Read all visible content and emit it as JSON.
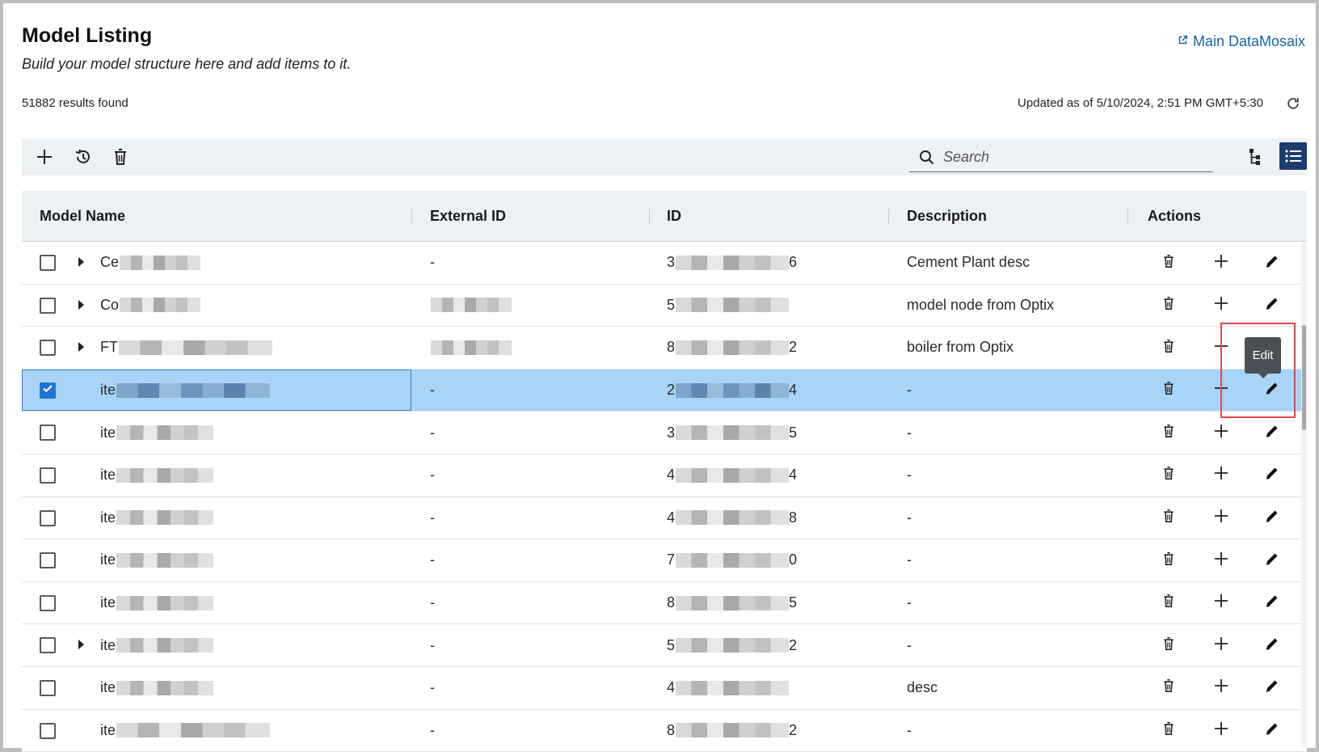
{
  "page": {
    "title": "Model Listing",
    "subtitle": "Build your model structure here and add items to it.",
    "main_link": "Main DataMosaix",
    "results": "51882 results found",
    "updated": "Updated as of 5/10/2024, 2:51 PM GMT+5:30"
  },
  "toolbar": {
    "search_placeholder": "Search"
  },
  "table": {
    "columns": [
      "Model Name",
      "External ID",
      "ID",
      "Description",
      "Actions"
    ],
    "rows": [
      {
        "name": "Ce",
        "ext": "-",
        "id_start": "3",
        "id_end": "6",
        "desc": "Cement Plant desc"
      },
      {
        "name": "Co",
        "ext": "",
        "id_start": "5",
        "id_end": "",
        "desc": "model node from Optix"
      },
      {
        "name": "FT",
        "ext": "",
        "id_start": "8",
        "id_end": "2",
        "desc": "boiler from Optix"
      },
      {
        "name": "ite",
        "ext": "-",
        "id_start": "2",
        "id_end": "4",
        "desc": "-"
      },
      {
        "name": "ite",
        "ext": "-",
        "id_start": "3",
        "id_end": "5",
        "desc": "-"
      },
      {
        "name": "ite",
        "ext": "-",
        "id_start": "4",
        "id_end": "4",
        "desc": "-"
      },
      {
        "name": "ite",
        "ext": "-",
        "id_start": "4",
        "id_end": "8",
        "desc": "-"
      },
      {
        "name": "ite",
        "ext": "-",
        "id_start": "7",
        "id_end": "0",
        "desc": "-"
      },
      {
        "name": "ite",
        "ext": "-",
        "id_start": "8",
        "id_end": "5",
        "desc": "-"
      },
      {
        "name": "ite",
        "ext": "-",
        "id_start": "5",
        "id_end": "2",
        "desc": "-"
      },
      {
        "name": "ite",
        "ext": "-",
        "id_start": "4",
        "id_end": "",
        "desc": "desc"
      },
      {
        "name": "ite",
        "ext": "-",
        "id_start": "8",
        "id_end": "2",
        "desc": "-"
      }
    ]
  },
  "tooltip": {
    "text": "Edit"
  },
  "colors": {
    "accent": "#1a3d6d",
    "link": "#1565a8",
    "selected_row": "#a8d4f7",
    "highlight": "#e0474c"
  }
}
